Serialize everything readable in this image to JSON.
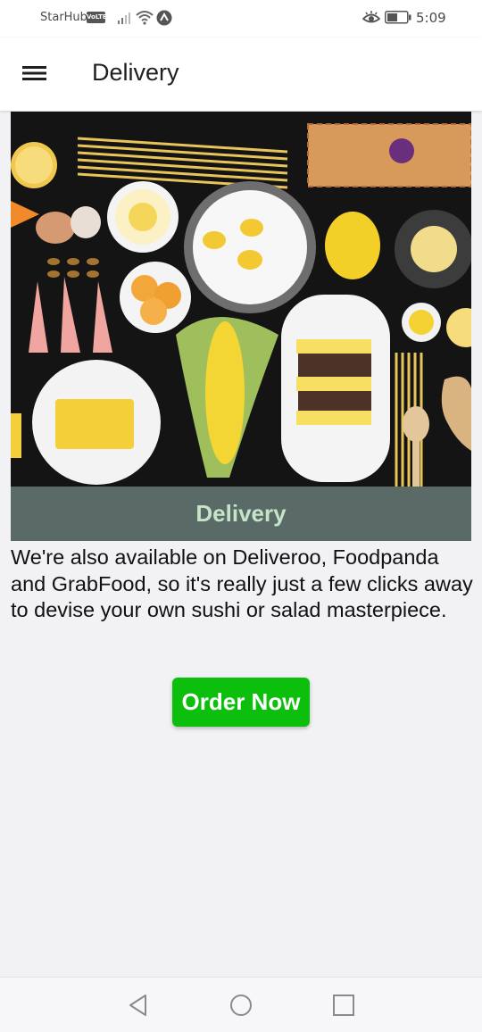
{
  "status_bar": {
    "carrier": "StarHub",
    "volte_badge": "VoLTE",
    "time": "5:09"
  },
  "app_bar": {
    "title": "Delivery"
  },
  "hero": {
    "caption": "Delivery"
  },
  "content": {
    "description": "We're also available on Deliveroo, Foodpanda and GrabFood, so it's really just a few clicks away to devise your own sushi or salad masterpiece.",
    "order_button_label": "Order Now"
  },
  "colors": {
    "caption_bg": "#5a6a66",
    "caption_text": "#c5e4c8",
    "order_button": "#0cbf0c"
  }
}
